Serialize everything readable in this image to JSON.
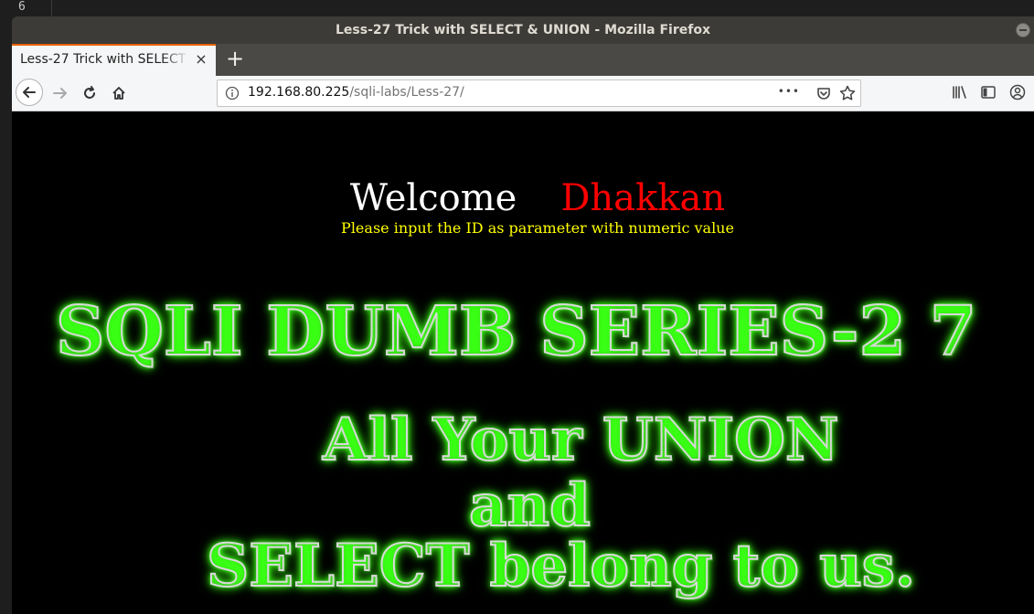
{
  "background": {
    "line_number": "6"
  },
  "window": {
    "title": "Less-27 Trick with SELECT & UNION - Mozilla Firefox"
  },
  "tab": {
    "label": "Less-27 Trick with SELECT & UNION",
    "close": "×",
    "new_tab": "+"
  },
  "navbar": {
    "url_host": "192.168.80.225",
    "url_path": "/sqli-labs/Less-27/",
    "page_actions": "•••"
  },
  "page": {
    "welcome": "Welcome",
    "name": "Dhakkan",
    "hint": "Please input the ID as parameter with numeric value",
    "banner_line1": "SQLI DUMB SERIES-2 7",
    "banner_line2": "All Your UNION",
    "banner_line3": "and",
    "banner_line4": "SELECT belong to us."
  },
  "colors": {
    "welcome": "#ffffff",
    "name": "#ff0000",
    "hint": "#ffff00",
    "glow": "#39ff14",
    "tab_accent": "#e66000"
  }
}
